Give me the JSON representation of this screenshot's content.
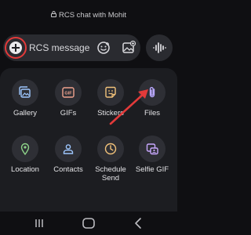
{
  "header": {
    "title": "RCS chat with Mohit",
    "lock_icon": "lock-icon"
  },
  "composer": {
    "placeholder": "RCS message",
    "add_icon": "plus-circle-icon",
    "emoji_icon": "emoji-icon",
    "gallery_icon": "image-add-icon",
    "voice_icon": "voice-waveform-icon",
    "highlight_color": "#e23a3a"
  },
  "attachments": [
    {
      "label": "Gallery",
      "icon": "gallery-icon",
      "color": "#9ec7ff"
    },
    {
      "label": "GIFs",
      "icon": "gif-icon",
      "color": "#f0a38e"
    },
    {
      "label": "Stickers",
      "icon": "sticker-icon",
      "color": "#f2c27a"
    },
    {
      "label": "Files",
      "icon": "paperclip-icon",
      "color": "#b9a8ff"
    },
    {
      "label": "Location",
      "icon": "location-pin-icon",
      "color": "#8fd48a"
    },
    {
      "label": "Contacts",
      "icon": "contact-icon",
      "color": "#9ec7ff"
    },
    {
      "label": "Schedule Send",
      "icon": "clock-icon",
      "color": "#f2c27a"
    },
    {
      "label": "Selfie GIF",
      "icon": "selfie-gif-icon",
      "color": "#c9a8ff"
    }
  ],
  "annotation": {
    "arrow_color": "#e23a3a",
    "points_to": "Files"
  },
  "nav": {
    "recents_icon": "recents-icon",
    "home_icon": "home-icon",
    "back_icon": "back-icon"
  }
}
